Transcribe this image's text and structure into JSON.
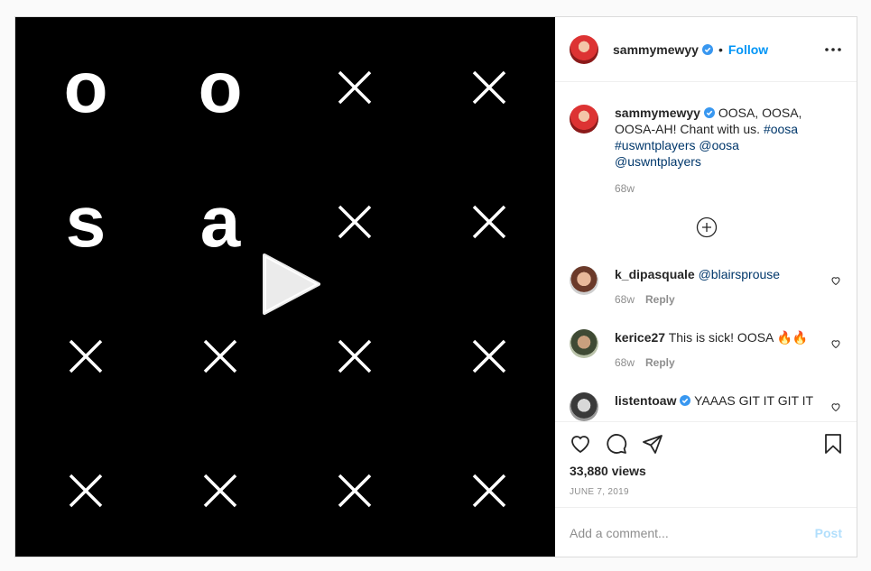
{
  "media": {
    "tiles": [
      "o",
      "o",
      "x",
      "x",
      "s",
      "a",
      "x",
      "x",
      "x",
      "x",
      "x",
      "x",
      "x",
      "x",
      "x",
      "x"
    ]
  },
  "header": {
    "username": "sammymewyy",
    "dot": "•",
    "follow_label": "Follow"
  },
  "caption": {
    "username": "sammymewyy",
    "text": "OOSA, OOSA, OOSA-AH! Chant with us.",
    "tags": "#oosa #uswntplayers @oosa @uswntplayers",
    "age": "68w"
  },
  "comments": [
    {
      "username": "k_dipasquale",
      "text": "@blairsprouse",
      "age": "68w",
      "reply": "Reply"
    },
    {
      "username": "kerice27",
      "text": "This is sick! OOSA 🔥🔥",
      "age": "68w",
      "reply": "Reply"
    },
    {
      "username": "listentoaw",
      "text": "YAAAS GIT IT GIT IT",
      "age": "",
      "reply": ""
    }
  ],
  "stats": {
    "views": "33,880 views",
    "date": "JUNE 7, 2019"
  },
  "add_comment": {
    "placeholder": "Add a comment...",
    "post_label": "Post"
  },
  "colors": {
    "link": "#0095f6",
    "hashtag": "#00376b",
    "verified": "#3897f0"
  }
}
